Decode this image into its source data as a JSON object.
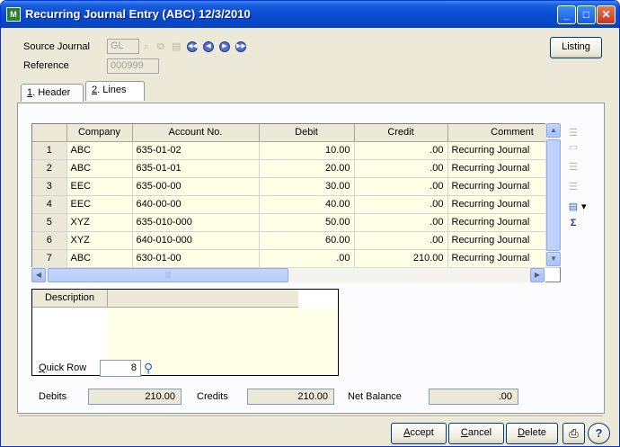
{
  "window": {
    "title": "Recurring Journal Entry (ABC) 12/3/2010",
    "icon_text": "M"
  },
  "header": {
    "source_journal_label": "Source Journal",
    "source_journal_value": "GL",
    "reference_label": "Reference",
    "reference_value": "000999",
    "listing_label": "Listing"
  },
  "tabs": [
    {
      "key": "1",
      "label": ". Header"
    },
    {
      "key": "2",
      "label": ". Lines"
    }
  ],
  "grid": {
    "columns": [
      "Company",
      "Account No.",
      "Debit",
      "Credit",
      "Comment"
    ],
    "rows": [
      {
        "num": "1",
        "company": "ABC",
        "account": "635-01-02",
        "debit": "10.00",
        "credit": ".00",
        "comment": "Recurring Journal"
      },
      {
        "num": "2",
        "company": "ABC",
        "account": "635-01-01",
        "debit": "20.00",
        "credit": ".00",
        "comment": "Recurring Journal"
      },
      {
        "num": "3",
        "company": "EEC",
        "account": "635-00-00",
        "debit": "30.00",
        "credit": ".00",
        "comment": "Recurring Journal"
      },
      {
        "num": "4",
        "company": "EEC",
        "account": "640-00-00",
        "debit": "40.00",
        "credit": ".00",
        "comment": "Recurring Journal"
      },
      {
        "num": "5",
        "company": "XYZ",
        "account": "635-010-000",
        "debit": "50.00",
        "credit": ".00",
        "comment": "Recurring Journal"
      },
      {
        "num": "6",
        "company": "XYZ",
        "account": "640-010-000",
        "debit": "60.00",
        "credit": ".00",
        "comment": "Recurring Journal"
      },
      {
        "num": "7",
        "company": "ABC",
        "account": "630-01-00",
        "debit": ".00",
        "credit": "210.00",
        "comment": "Recurring Journal"
      }
    ]
  },
  "description": {
    "label": "Description"
  },
  "quick_row": {
    "label_key": "Q",
    "label_rest": "uick Row",
    "value": "8"
  },
  "totals": {
    "debits_label": "Debits",
    "debits_value": "210.00",
    "credits_label": "Credits",
    "credits_value": "210.00",
    "net_label": "Net Balance",
    "net_value": ".00"
  },
  "footer": {
    "accept_key": "A",
    "accept_rest": "ccept",
    "cancel_key": "C",
    "cancel_rest": "ancel",
    "delete_key": "D",
    "delete_rest": "elete"
  },
  "icons": {
    "nav": [
      "first-record-icon",
      "previous-record-icon",
      "next-record-icon",
      "last-record-icon"
    ],
    "side_tools": [
      "insert-row-icon",
      "delete-row-icon",
      "move-up-icon",
      "move-down-icon",
      "customize-icon",
      "sum-icon"
    ]
  },
  "colors": {
    "titlebar": "#0a4bd0",
    "grid_cell": "#ffffe8",
    "window_bg": "#ece9d8"
  }
}
